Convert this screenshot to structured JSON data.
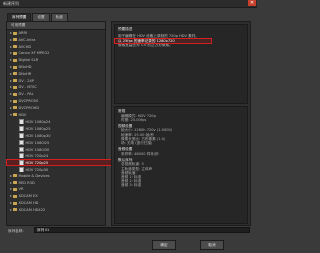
{
  "window": {
    "title": "新建序列",
    "close_glyph": "✕"
  },
  "tabs": [
    {
      "label": "序列预置"
    },
    {
      "label": "设置"
    },
    {
      "label": "轨道"
    }
  ],
  "presets": {
    "header": "可用预置",
    "items": [
      {
        "label": "ARRI",
        "kind": "folder",
        "indent": 0
      },
      {
        "label": "AVC-Intra",
        "kind": "folder",
        "indent": 0
      },
      {
        "label": "AVCHD",
        "kind": "folder",
        "indent": 0
      },
      {
        "label": "Canon XF MPEG2",
        "kind": "folder",
        "indent": 0
      },
      {
        "label": "Digital SLR",
        "kind": "folder",
        "indent": 0
      },
      {
        "label": "DNxHD",
        "kind": "folder",
        "indent": 0
      },
      {
        "label": "DNxHR",
        "kind": "folder",
        "indent": 0
      },
      {
        "label": "DV - 24P",
        "kind": "folder",
        "indent": 0
      },
      {
        "label": "DV - NTSC",
        "kind": "folder",
        "indent": 0
      },
      {
        "label": "DV - PAL",
        "kind": "folder",
        "indent": 0
      },
      {
        "label": "DVCPRO50",
        "kind": "folder",
        "indent": 0
      },
      {
        "label": "DVCPROHD",
        "kind": "folder",
        "indent": 0
      },
      {
        "label": "HDV",
        "kind": "folder-open",
        "indent": 0
      },
      {
        "label": "HDV 1080p24",
        "kind": "file",
        "indent": 1
      },
      {
        "label": "HDV 1080p25",
        "kind": "file",
        "indent": 1
      },
      {
        "label": "HDV 1080p30",
        "kind": "file",
        "indent": 1
      },
      {
        "label": "HDV 1080i25",
        "kind": "file",
        "indent": 1
      },
      {
        "label": "HDV 1080i30",
        "kind": "file",
        "indent": 1
      },
      {
        "label": "HDV 720p24",
        "kind": "file",
        "indent": 1
      },
      {
        "label": "HDV 720p25",
        "kind": "file",
        "indent": 1,
        "selected": true
      },
      {
        "label": "HDV 720p30",
        "kind": "file",
        "indent": 1
      },
      {
        "label": "Mobile & Devices",
        "kind": "folder",
        "indent": 0
      },
      {
        "label": "RED R3D",
        "kind": "folder",
        "indent": 0
      },
      {
        "label": "VR",
        "kind": "folder",
        "indent": 0
      },
      {
        "label": "XDCAM EX",
        "kind": "folder",
        "indent": 0
      },
      {
        "label": "XDCAM HD",
        "kind": "folder",
        "indent": 0
      },
      {
        "label": "XDCAM HD422",
        "kind": "folder",
        "indent": 0
      }
    ]
  },
  "description": {
    "title": "预置描述",
    "lines": [
      "用于编辑在 HDV 设备上录制的 720p HDV 素材。",
      "以 25fps 的速率记录的 1280x720",
      "像素宽高比为 1.0 的正方形像素。"
    ],
    "highlight_index": 1
  },
  "settings": [
    {
      "head": "常规",
      "lines": [
        "编辑模式: HDV 720p",
        "时基: 25.00fps"
      ]
    },
    {
      "head": "视频设置",
      "lines": [
        "帧大小: 1280h 720v (1.0000)",
        "帧速率: 25.00 帧/秒",
        "像素长宽比: 方形像素 (1.0)",
        "场: 无场 (逐行扫描)"
      ]
    },
    {
      "head": "音频设置",
      "lines": [
        "采样率: 48000 样本/秒"
      ]
    },
    {
      "head": "默认序列",
      "lines": [
        "总视频轨道: 3",
        "主轨道类型: 立体声",
        "音频轨道:",
        "音频 1: 标准",
        "音频 2: 标准",
        "音频 3: 标准"
      ]
    }
  ],
  "sequence_name": {
    "label": "序列名称:",
    "value": "序列 01"
  },
  "buttons": {
    "ok": "确定",
    "cancel": "取消"
  }
}
